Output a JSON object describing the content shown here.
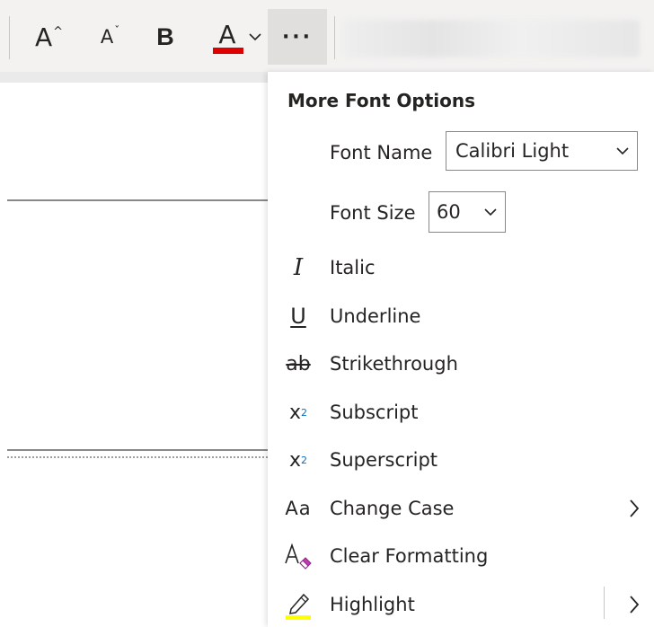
{
  "toolbar": {
    "grow_font_glyph": "A",
    "shrink_font_glyph": "A",
    "bold_glyph": "B",
    "font_color_glyph": "A",
    "font_color_value": "#e00000",
    "more_glyph": "···"
  },
  "panel": {
    "title": "More Font Options",
    "font_name_label": "Font Name",
    "font_name_value": "Calibri Light",
    "font_size_label": "Font Size",
    "font_size_value": "60",
    "items": [
      {
        "label": "Italic",
        "icon": "italic-icon",
        "glyph": "I"
      },
      {
        "label": "Underline",
        "icon": "underline-icon",
        "glyph": "U"
      },
      {
        "label": "Strikethrough",
        "icon": "strikethrough-icon",
        "glyph": "ab"
      },
      {
        "label": "Subscript",
        "icon": "subscript-icon",
        "glyph": "x",
        "sub": "2"
      },
      {
        "label": "Superscript",
        "icon": "superscript-icon",
        "glyph": "x",
        "sup": "2"
      },
      {
        "label": "Change Case",
        "icon": "change-case-icon",
        "glyph": "Aa"
      },
      {
        "label": "Clear Formatting",
        "icon": "clear-formatting-icon"
      },
      {
        "label": "Highlight",
        "icon": "highlight-icon",
        "highlight_color": "#ffff00"
      }
    ]
  }
}
